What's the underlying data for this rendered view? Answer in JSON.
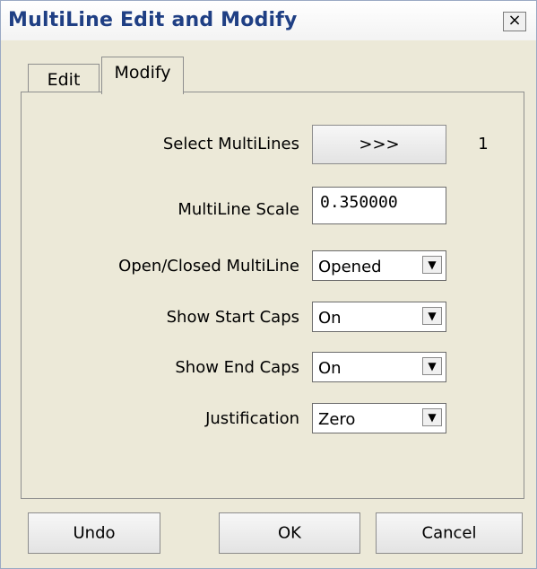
{
  "window": {
    "title": "MultiLine Edit and Modify",
    "close_icon": "×"
  },
  "tabs": [
    {
      "label": "Edit"
    },
    {
      "label": "Modify"
    }
  ],
  "form": {
    "select_multilines": {
      "label": "Select MultiLines",
      "button": ">>>",
      "count": "1"
    },
    "multiline_scale": {
      "label": "MultiLine Scale",
      "value": "0.350000"
    },
    "open_closed": {
      "label": "Open/Closed MultiLine",
      "value": "Opened"
    },
    "show_start_caps": {
      "label": "Show Start Caps",
      "value": "On"
    },
    "show_end_caps": {
      "label": "Show End Caps",
      "value": "On"
    },
    "justification": {
      "label": "Justification",
      "value": "Zero"
    }
  },
  "footer": {
    "undo": "Undo",
    "ok": "OK",
    "cancel": "Cancel"
  },
  "icons": {
    "dropdown": "chevron-down-icon",
    "close": "close-icon"
  }
}
